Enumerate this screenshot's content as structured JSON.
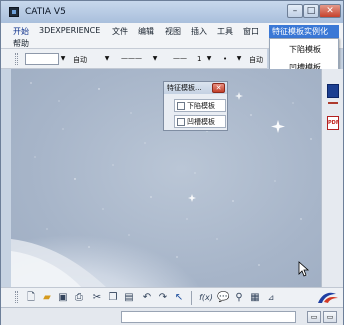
{
  "window": {
    "title": "CATIA V5"
  },
  "menubar": {
    "items": [
      "开始",
      "3DEXPERIENCE",
      "文件",
      "编辑",
      "视图",
      "插入",
      "工具",
      "窗口"
    ],
    "second_row": "帮助",
    "highlighted": "特征模板实例化"
  },
  "dropdown": {
    "items": [
      "下陷模板",
      "凹槽模板"
    ]
  },
  "toolbar": {
    "auto1": "自动",
    "line_style": "1",
    "auto2": "自动"
  },
  "feature_panel": {
    "title": "特征模板...",
    "buttons": [
      "下陷模板",
      "凹槽模板"
    ]
  },
  "bottom_toolbar": {
    "icons": [
      "new-icon",
      "open-icon",
      "save-icon",
      "print-icon",
      "cut-icon",
      "copy-icon",
      "paste-icon",
      "undo-icon",
      "redo-icon",
      "whats-this-icon",
      "formula-icon",
      "comment-icon",
      "sensor-icon",
      "table-icon",
      "parameter-icon"
    ],
    "formula_label": "f(x)"
  },
  "side_strip": {
    "pdf_label": "PDF"
  },
  "colors": {
    "menu_highlight": "#3a78d6",
    "close_button": "#c6412c",
    "viewport": "#a7b5c9"
  }
}
